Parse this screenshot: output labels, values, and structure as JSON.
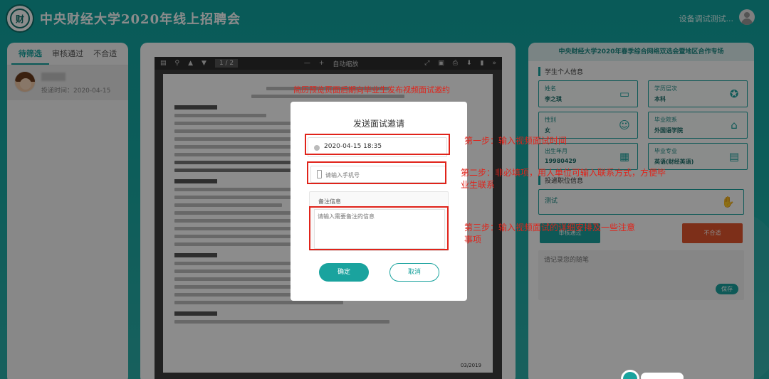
{
  "header": {
    "title": "中央财经大学2020年线上招聘会",
    "logo_text": "财",
    "user_name": "设备调试测试..."
  },
  "left_panel": {
    "tabs": [
      {
        "label": "待筛选"
      },
      {
        "label": "审核通过"
      },
      {
        "label": "不合适"
      }
    ],
    "candidate": {
      "date_label": "投递时间：2020-04-15"
    }
  },
  "pdf": {
    "page_indicator": "1 / 2",
    "zoom": "自动缩放",
    "page_footer": "03/2019"
  },
  "right_panel": {
    "title": "中央财经大学2020年春季综合网络双选会暨地区合作专场",
    "section_student": "学生个人信息",
    "fields": [
      {
        "label": "姓名",
        "value": "李之琪",
        "icon": "id-card-icon"
      },
      {
        "label": "学历层次",
        "value": "本科",
        "icon": "award-icon"
      },
      {
        "label": "性别",
        "value": "女",
        "icon": "person-icon"
      },
      {
        "label": "毕业院系",
        "value": "外国语学院",
        "icon": "building-icon"
      },
      {
        "label": "出生年月",
        "value": "19980429",
        "icon": "calendar-icon"
      },
      {
        "label": "毕业专业",
        "value": "英语(财经英语)",
        "icon": "book-icon"
      }
    ],
    "section_position": "投递职位信息",
    "position": {
      "value": "测试",
      "icon": "handshake-icon"
    },
    "pass_label": "审核通过",
    "fail_label": "不合适",
    "notes_placeholder": "请记录您的随笔",
    "save_label": "保存"
  },
  "modal": {
    "title": "发送面试邀请",
    "datetime_value": "2020-04-15 18:35",
    "phone_placeholder": "请输入手机号",
    "notes_label": "备注信息",
    "notes_placeholder": "请输入需要备注的信息",
    "confirm_label": "确定",
    "cancel_label": "取消"
  },
  "annotations": {
    "top": "简历预览页面后期向毕业生发布视频面试邀约",
    "step1": "第一步：输入视频面试时间",
    "step2": "第二步：非必填项，用人单位可输入联系方式，方便毕业生联系",
    "step3": "第三步：输入视频面试的详细安排及一些注意事项"
  },
  "colors": {
    "brand": "#1aa39e",
    "annotation": "#e0231a",
    "fail": "#e4572e"
  }
}
